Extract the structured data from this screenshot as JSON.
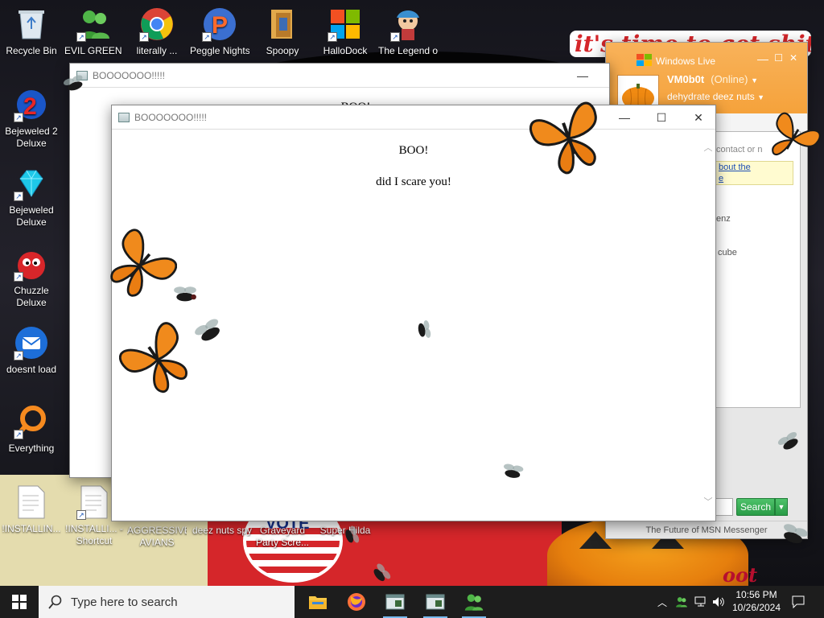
{
  "wallpaper": {
    "tagline": "it's time to get shit",
    "pin_text": "VOTE",
    "moth_text": "oot"
  },
  "desktop_icons": [
    {
      "label": "Recycle Bin",
      "icon": "recycle-bin-icon"
    },
    {
      "label": "EVIL GREEN MEN CO...",
      "icon": "msn-people-icon"
    },
    {
      "label": "literally ...",
      "icon": "chrome-icon"
    },
    {
      "label": "Peggle Nights Del...",
      "icon": "peggle-icon"
    },
    {
      "label": "Spoopy",
      "icon": "folder-icon"
    },
    {
      "label": "HalloDock",
      "icon": "windows-logo-icon"
    },
    {
      "label": "The Legend of Ti...",
      "icon": "game-character-icon"
    },
    {
      "label": "Bejeweled 2 Deluxe",
      "icon": "bejeweled2-icon"
    },
    {
      "label": "Bejeweled Deluxe",
      "icon": "diamond-icon"
    },
    {
      "label": "Chuzzle Deluxe",
      "icon": "chuzzle-icon"
    },
    {
      "label": "doesnt load",
      "icon": "thunderbird-icon"
    },
    {
      "label": "Everything",
      "icon": "everything-search-icon"
    },
    {
      "label": "!INSTALLIN...",
      "icon": "document-icon"
    },
    {
      "label": "!INSTALLI... - Shortcut",
      "icon": "document-icon"
    },
    {
      "label": "AGGRESSIVE AVIANS",
      "icon": "none"
    },
    {
      "label": "deez nuts spy",
      "icon": "none"
    },
    {
      "label": "Graveyard Party Scre...",
      "icon": "none"
    },
    {
      "label": "Super Hilda",
      "icon": "none"
    }
  ],
  "back_window": {
    "title": "BOOOOOOO!!!!!",
    "heading_partial": "BOO!",
    "minimize": "—"
  },
  "front_window": {
    "title": "BOOOOOOO!!!!!",
    "heading": "BOO!",
    "subtext": "did I scare you!",
    "minimize": "—",
    "maximize": "☐",
    "close": "✕"
  },
  "messenger": {
    "title": "Windows Live",
    "name": "VM0b0t",
    "status": "(Online)",
    "psm": "dehydrate deez nuts",
    "search_placeholder_partial": "contact or n",
    "link_text_1": "bout the",
    "link_text_2": "e",
    "list_item_1": "enz",
    "list_item_2": "cube",
    "search_button": "Search",
    "footer": "The Future of MSN Messenger"
  },
  "taskbar": {
    "search_placeholder": "Type here to search",
    "time": "10:56 PM",
    "date": "10/26/2024"
  }
}
